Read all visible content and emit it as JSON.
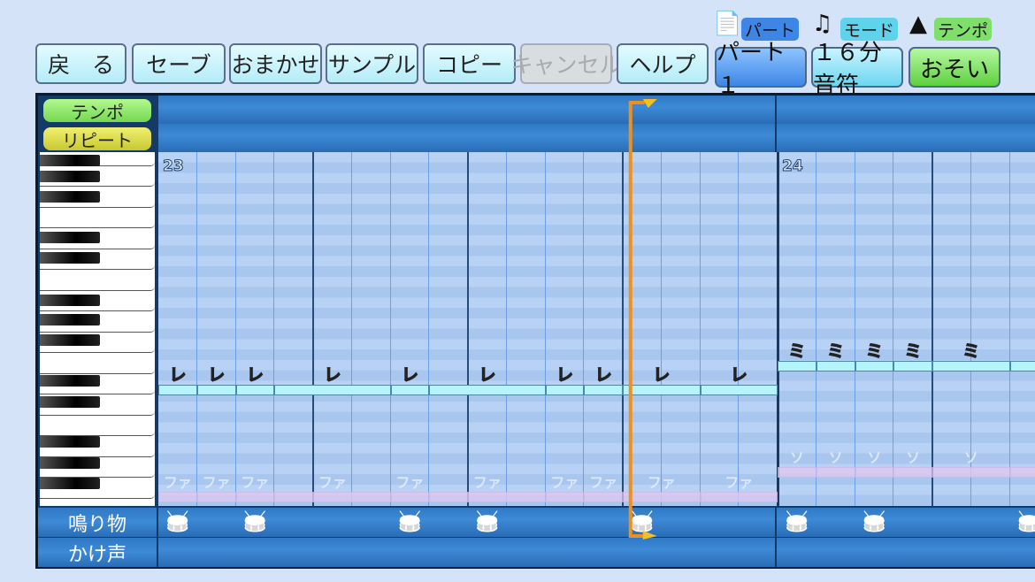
{
  "toolbar": {
    "buttons": [
      {
        "label": "戻　る",
        "enabled": true
      },
      {
        "label": "セーブ",
        "enabled": true
      },
      {
        "label": "おまかせ",
        "enabled": true
      },
      {
        "label": "サンプル",
        "enabled": true
      },
      {
        "label": "コピー",
        "enabled": true
      },
      {
        "label": "キャンセル",
        "enabled": false
      },
      {
        "label": "ヘルプ",
        "enabled": true
      }
    ],
    "part": {
      "label": "パート",
      "value": "パート１",
      "icon": "score-icon",
      "color": "#3d86e6"
    },
    "mode": {
      "label": "モード",
      "value": "１６分音符",
      "icon": "music-note-icon",
      "color": "#5fd3ec"
    },
    "tempo": {
      "label": "テンポ",
      "value": "おそい",
      "icon": "metronome-icon",
      "color": "#7ee06a"
    }
  },
  "tracks": {
    "tempo": "テンポ",
    "repeat": "リピート",
    "narimono": "鳴り物",
    "kakegoe": "かけ声"
  },
  "measures": [
    "23",
    "24"
  ],
  "notes": [
    {
      "name": "レ",
      "measure": 0,
      "start": 0,
      "len": 1
    },
    {
      "name": "レ",
      "measure": 0,
      "start": 1,
      "len": 1
    },
    {
      "name": "レ",
      "measure": 0,
      "start": 2,
      "len": 1
    },
    {
      "name": "レ",
      "measure": 0,
      "start": 3,
      "len": 3
    },
    {
      "name": "レ",
      "measure": 0,
      "start": 6,
      "len": 1
    },
    {
      "name": "レ",
      "measure": 0,
      "start": 7,
      "len": 3
    },
    {
      "name": "レ",
      "measure": 0,
      "start": 10,
      "len": 1
    },
    {
      "name": "レ",
      "measure": 0,
      "start": 11,
      "len": 1
    },
    {
      "name": "レ",
      "measure": 0,
      "start": 12,
      "len": 2
    },
    {
      "name": "レ",
      "measure": 0,
      "start": 14,
      "len": 2
    },
    {
      "name": "ミ",
      "measure": 1,
      "start": 0,
      "len": 1
    },
    {
      "name": "ミ",
      "measure": 1,
      "start": 1,
      "len": 1
    },
    {
      "name": "ミ",
      "measure": 1,
      "start": 2,
      "len": 1
    },
    {
      "name": "ミ",
      "measure": 1,
      "start": 3,
      "len": 1
    },
    {
      "name": "ミ",
      "measure": 1,
      "start": 4,
      "len": 2
    },
    {
      "name": "ミ",
      "measure": 1,
      "start": 6,
      "len": 2
    }
  ],
  "ghost_notes": [
    {
      "name": "ファ",
      "measure": 0,
      "starts": [
        [
          0,
          1
        ],
        [
          1,
          1
        ],
        [
          2,
          1
        ],
        [
          3,
          3
        ],
        [
          6,
          1
        ],
        [
          7,
          3
        ],
        [
          10,
          1
        ],
        [
          11,
          1
        ],
        [
          12,
          2
        ],
        [
          14,
          2
        ]
      ]
    },
    {
      "name": "ソ",
      "measure": 1,
      "starts": [
        [
          0,
          1
        ],
        [
          1,
          1
        ],
        [
          2,
          1
        ],
        [
          3,
          1
        ],
        [
          4,
          2
        ],
        [
          6,
          2
        ]
      ]
    }
  ],
  "drums": [
    {
      "measure": 0,
      "col": 0
    },
    {
      "measure": 0,
      "col": 2
    },
    {
      "measure": 0,
      "col": 6
    },
    {
      "measure": 0,
      "col": 8
    },
    {
      "measure": 0,
      "col": 12
    },
    {
      "measure": 1,
      "col": 0
    },
    {
      "measure": 1,
      "col": 2
    },
    {
      "measure": 1,
      "col": 6
    }
  ],
  "playhead": {
    "measure": 0,
    "position_sixteenths": 12.2,
    "color": "#f0901c"
  }
}
